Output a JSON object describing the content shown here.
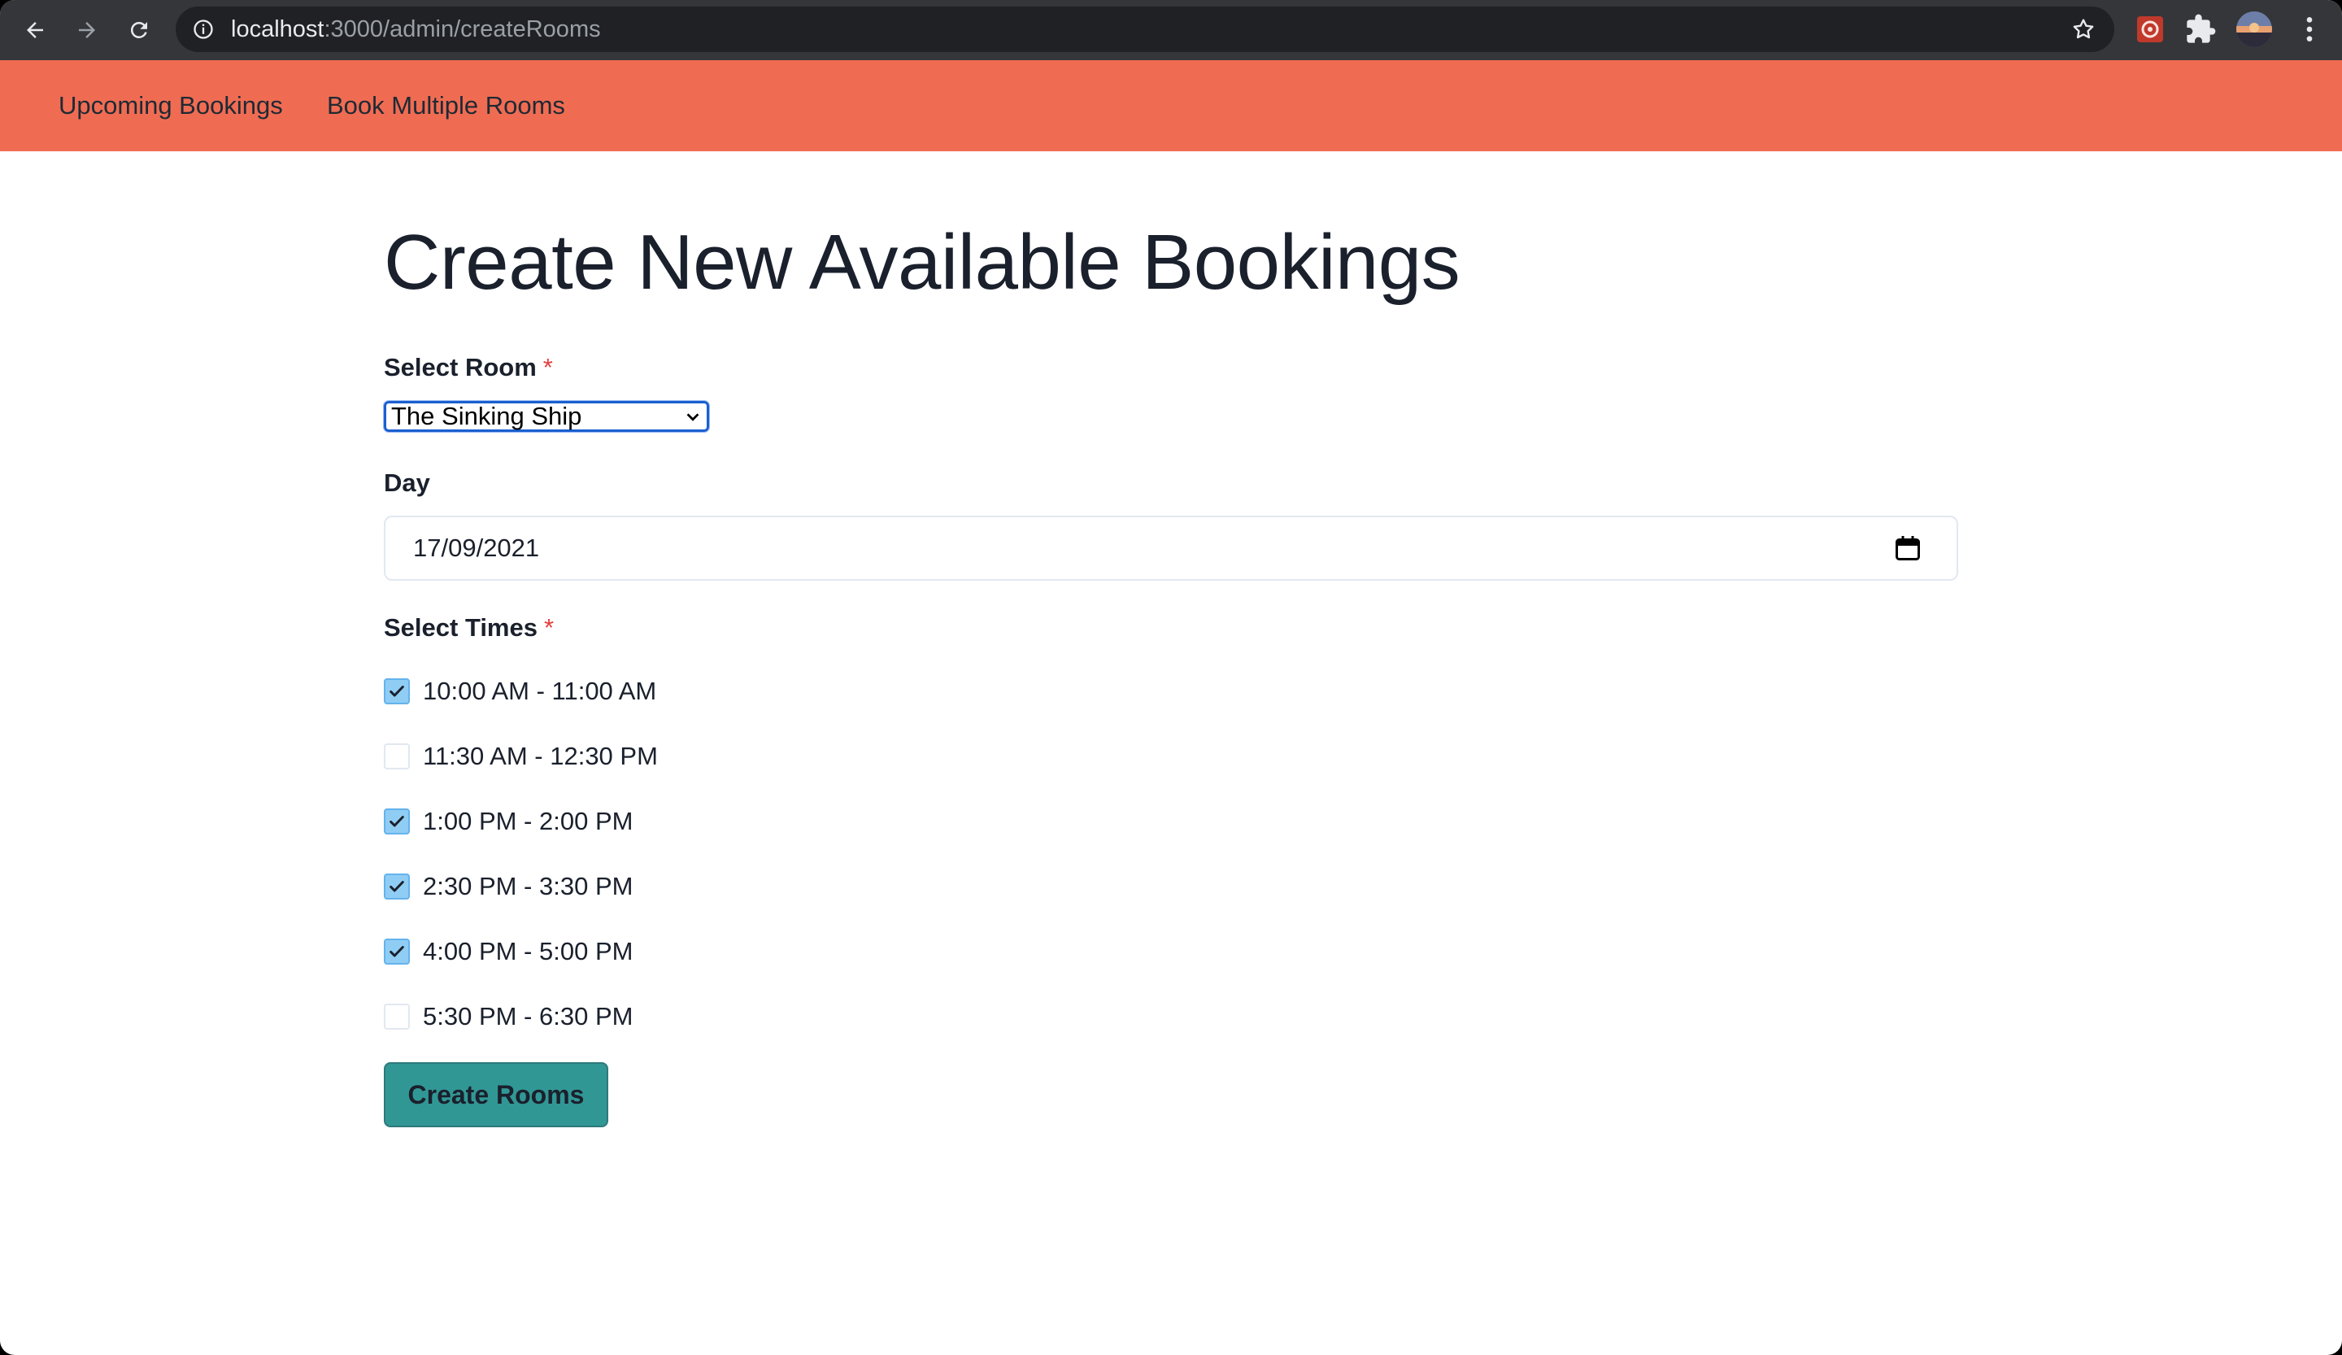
{
  "browser": {
    "url_host": "localhost",
    "url_rest": ":3000/admin/createRooms",
    "icons": [
      "back-arrow-icon",
      "forward-arrow-icon",
      "reload-icon",
      "info-icon",
      "star-icon",
      "extension-icon",
      "puzzle-icon",
      "profile-avatar",
      "more-menu-icon"
    ]
  },
  "navbar": {
    "links": [
      "Upcoming Bookings",
      "Book Multiple Rooms"
    ],
    "background": "#ef6c53"
  },
  "page": {
    "title": "Create New Available Bookings",
    "room_label": "Select Room",
    "required_mark": "*",
    "room_selected": "The Sinking Ship",
    "day_label": "Day",
    "day_value": "17/09/2021",
    "times_label": "Select Times",
    "times": [
      {
        "label": "10:00 AM - 11:00 AM",
        "checked": true
      },
      {
        "label": "11:30 AM - 12:30 PM",
        "checked": false
      },
      {
        "label": "1:00 PM - 2:00 PM",
        "checked": true
      },
      {
        "label": "2:30 PM - 3:30 PM",
        "checked": true
      },
      {
        "label": "4:00 PM - 5:00 PM",
        "checked": true
      },
      {
        "label": "5:30 PM - 6:30 PM",
        "checked": false
      }
    ],
    "submit_label": "Create Rooms",
    "accent": "#319795"
  }
}
